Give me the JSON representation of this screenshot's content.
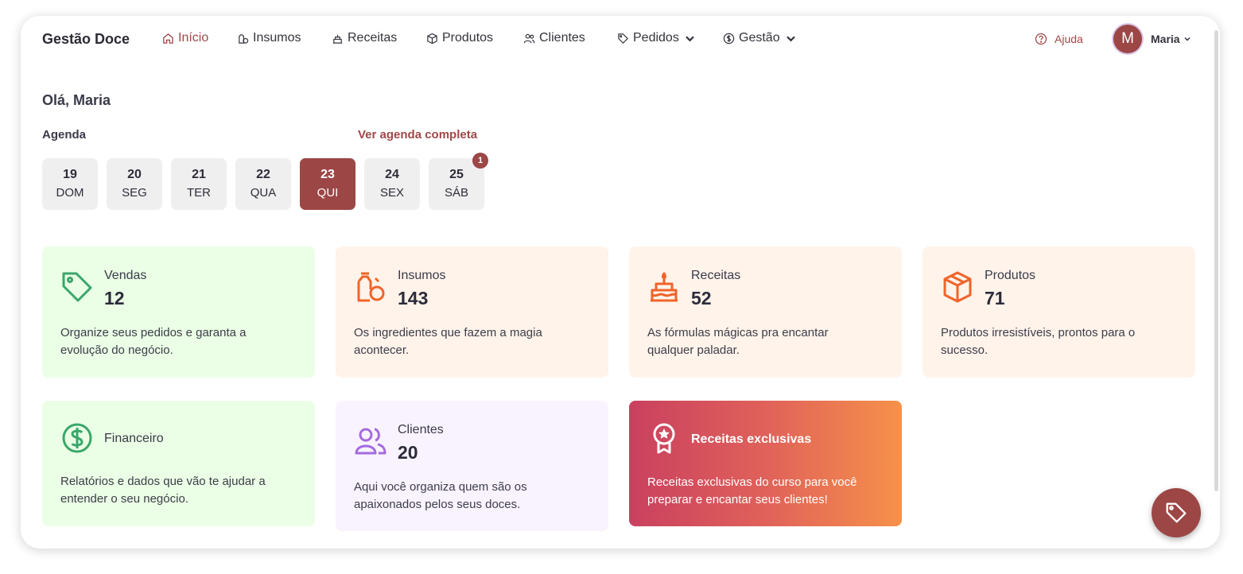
{
  "app": {
    "brand": "Gestão Doce"
  },
  "nav": {
    "items": [
      {
        "label": "Início",
        "icon": "home-icon",
        "active": true
      },
      {
        "label": "Insumos",
        "icon": "ingredients-icon"
      },
      {
        "label": "Receitas",
        "icon": "cake-icon"
      },
      {
        "label": "Produtos",
        "icon": "box-icon"
      },
      {
        "label": "Clientes",
        "icon": "users-icon"
      },
      {
        "label": "Pedidos",
        "icon": "tag-icon",
        "dropdown": true
      },
      {
        "label": "Gestão",
        "icon": "dollar-icon",
        "dropdown": true
      }
    ],
    "help_label": "Ajuda",
    "avatar_letter": "M",
    "user_name": "Maria"
  },
  "greeting": "Olá, Maria",
  "agenda": {
    "title": "Agenda",
    "link": "Ver agenda completa",
    "days": [
      {
        "num": "19",
        "dow": "DOM"
      },
      {
        "num": "20",
        "dow": "SEG"
      },
      {
        "num": "21",
        "dow": "TER"
      },
      {
        "num": "22",
        "dow": "QUA"
      },
      {
        "num": "23",
        "dow": "QUI",
        "selected": true
      },
      {
        "num": "24",
        "dow": "SEX"
      },
      {
        "num": "25",
        "dow": "SÁB",
        "badge": "1"
      }
    ]
  },
  "cards": {
    "vendas": {
      "label": "Vendas",
      "count": "12",
      "desc": "Organize seus pedidos e garanta a evolução do negócio.",
      "icon": "tag-icon"
    },
    "insumos": {
      "label": "Insumos",
      "count": "143",
      "desc": "Os ingredientes que fazem a magia acontecer.",
      "icon": "ingredients-icon"
    },
    "receitas": {
      "label": "Receitas",
      "count": "52",
      "desc": "As fórmulas mágicas pra encantar qualquer paladar.",
      "icon": "cake-icon"
    },
    "produtos": {
      "label": "Produtos",
      "count": "71",
      "desc": "Produtos irresistíveis, prontos para o sucesso.",
      "icon": "box-icon"
    },
    "financeiro": {
      "label": "Financeiro",
      "desc": "Relatórios e dados que vão te ajudar a entender o seu negócio.",
      "icon": "dollar-icon"
    },
    "clientes": {
      "label": "Clientes",
      "count": "20",
      "desc": "Aqui você organiza quem são os apaixonados pelos seus doces.",
      "icon": "users-icon"
    },
    "exclusivas": {
      "label": "Receitas exclusivas",
      "desc": "Receitas exclusivas do curso para você preparar e encantar seus clientes!",
      "icon": "award-icon"
    }
  },
  "colors": {
    "accent": "#9c4646",
    "green": "#3aa66a",
    "orange": "#f0642a",
    "purple": "#a46be0"
  }
}
